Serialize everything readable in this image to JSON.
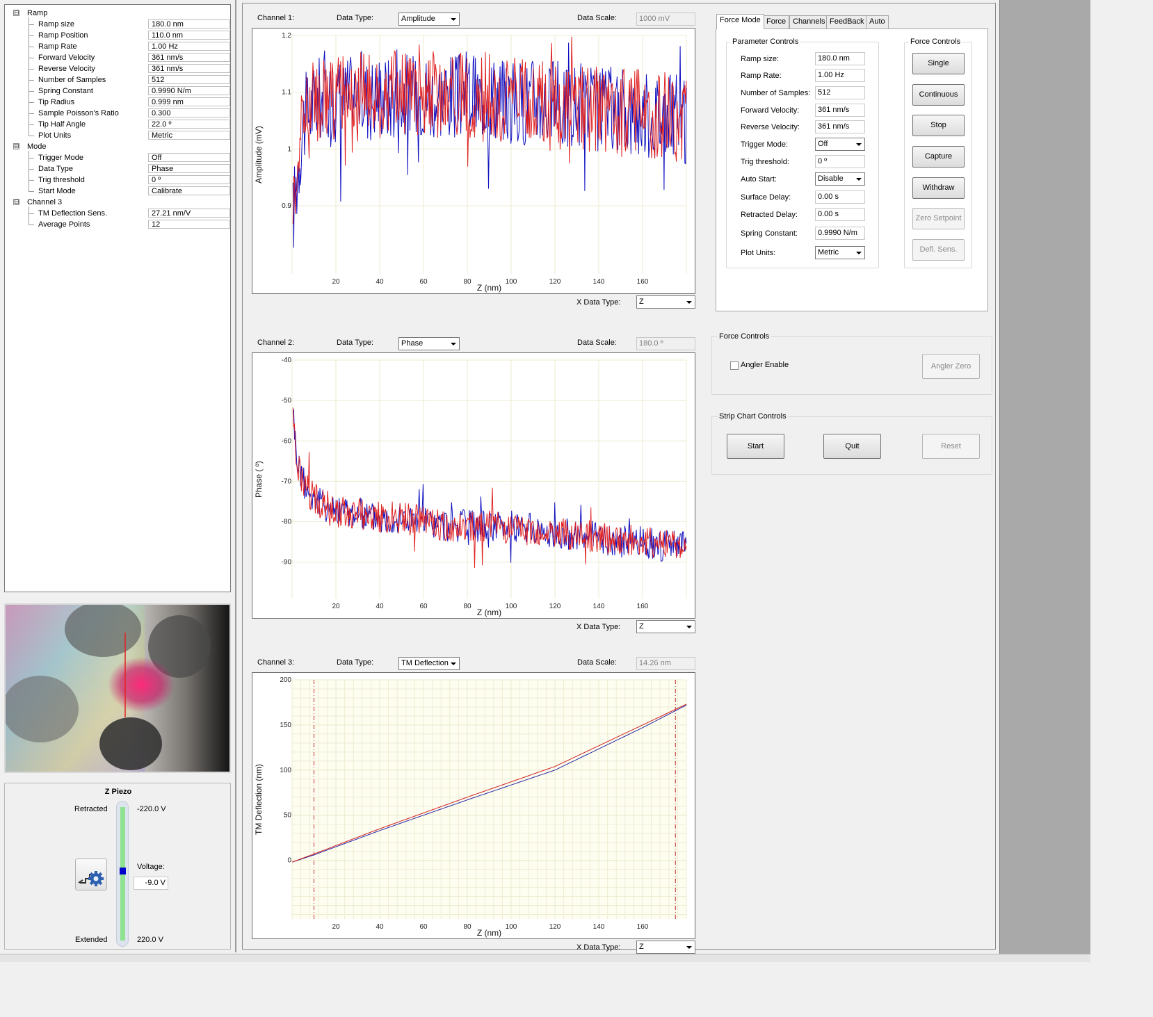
{
  "tree": {
    "sections": [
      {
        "label": "Ramp",
        "toggle": "⊟",
        "rows": [
          {
            "label": "Ramp size",
            "value": "180.0 nm"
          },
          {
            "label": "Ramp Position",
            "value": "110.0 nm"
          },
          {
            "label": "Ramp Rate",
            "value": "1.00 Hz"
          },
          {
            "label": "Forward Velocity",
            "value": "361 nm/s"
          },
          {
            "label": "Reverse Velocity",
            "value": "361 nm/s"
          },
          {
            "label": "Number of Samples",
            "value": "512"
          },
          {
            "label": "Spring Constant",
            "value": "0.9990 N/m"
          },
          {
            "label": "Tip Radius",
            "value": "0.999 nm"
          },
          {
            "label": "Sample Poisson's Ratio",
            "value": "0.300"
          },
          {
            "label": "Tip Half Angle",
            "value": "22.0 º"
          },
          {
            "label": "Plot Units",
            "value": "Metric"
          }
        ]
      },
      {
        "label": "Mode",
        "toggle": "⊟",
        "rows": [
          {
            "label": "Trigger Mode",
            "value": "Off"
          },
          {
            "label": "Data Type",
            "value": "Phase"
          },
          {
            "label": "Trig threshold",
            "value": "0 º"
          },
          {
            "label": "Start Mode",
            "value": "Calibrate"
          }
        ]
      },
      {
        "label": "Channel 3",
        "toggle": "⊟",
        "rows": [
          {
            "label": "TM Deflection Sens.",
            "value": "27.21 nm/V"
          },
          {
            "label": "Average Points",
            "value": "12"
          }
        ]
      }
    ]
  },
  "zpiezo": {
    "title": "Z Piezo",
    "retracted_label": "Retracted",
    "retracted_value": "-220.0 V",
    "extended_label": "Extended",
    "extended_value": "220.0 V",
    "voltage_label": "Voltage:",
    "voltage_value": "-9.0 V",
    "voltage_min": -220,
    "voltage_max": 220,
    "voltage": -9.0,
    "icon": "stepper-gear-icon"
  },
  "channels": [
    {
      "label": "Channel 1:",
      "data_type_label": "Data Type:",
      "data_type": "Amplitude",
      "scale_label": "Data Scale:",
      "scale": "1000 mV",
      "x_type_label": "X Data Type:",
      "x_type": "Z"
    },
    {
      "label": "Channel 2:",
      "data_type_label": "Data Type:",
      "data_type": "Phase",
      "scale_label": "Data Scale:",
      "scale": "180.0 º",
      "x_type_label": "X Data Type:",
      "x_type": "Z"
    },
    {
      "label": "Channel 3:",
      "data_type_label": "Data Type:",
      "data_type": "TM Deflection",
      "scale_label": "Data Scale:",
      "scale": "14.26 nm",
      "x_type_label": "X Data Type:",
      "x_type": "Z"
    }
  ],
  "chart_data": [
    {
      "type": "line",
      "title": "",
      "xlabel": "Z (nm)",
      "ylabel": "Amplitude (mV)",
      "xlim": [
        0,
        180
      ],
      "ylim": [
        0.78,
        1.2
      ],
      "xticks": [
        20,
        40,
        60,
        80,
        100,
        120,
        140,
        160
      ],
      "yticks": [
        0.9,
        1,
        1.1,
        1.2
      ],
      "ytick_labels": [
        "0.9",
        "1",
        "1.1",
        "1.2"
      ],
      "grid": true,
      "series": [
        {
          "color": "#1010c0",
          "x": [
            0.4,
            5,
            10,
            15,
            20,
            25,
            30,
            35,
            40,
            45,
            50,
            55,
            60,
            65,
            70,
            75,
            80,
            85,
            90,
            95,
            100,
            105,
            110,
            115,
            120,
            125,
            130,
            135,
            140,
            145,
            150,
            155,
            160,
            165,
            170,
            175,
            180
          ],
          "y": [
            0.88,
            1.05,
            1.08,
            1.1,
            1.08,
            1.09,
            1.1,
            1.09,
            1.1,
            1.09,
            1.1,
            1.09,
            1.1,
            1.09,
            1.1,
            1.09,
            1.1,
            1.09,
            1.1,
            1.09,
            1.08,
            1.08,
            1.09,
            1.08,
            1.08,
            1.07,
            1.08,
            1.07,
            1.07,
            1.07,
            1.07,
            1.06,
            1.06,
            1.06,
            1.06,
            1.06,
            1.04
          ]
        },
        {
          "color": "#e02020",
          "x": [
            0.4,
            5,
            10,
            15,
            20,
            25,
            30,
            35,
            40,
            45,
            50,
            55,
            60,
            65,
            70,
            75,
            80,
            85,
            90,
            95,
            100,
            105,
            110,
            115,
            120,
            125,
            130,
            135,
            140,
            145,
            150,
            155,
            160,
            165,
            170,
            175,
            180
          ],
          "y": [
            0.92,
            1.06,
            1.08,
            1.09,
            1.09,
            1.1,
            1.09,
            1.1,
            1.09,
            1.1,
            1.09,
            1.1,
            1.09,
            1.1,
            1.09,
            1.1,
            1.09,
            1.1,
            1.09,
            1.08,
            1.09,
            1.08,
            1.08,
            1.08,
            1.07,
            1.08,
            1.07,
            1.07,
            1.07,
            1.07,
            1.06,
            1.07,
            1.06,
            1.06,
            1.06,
            1.05,
            1.05
          ]
        }
      ]
    },
    {
      "type": "line",
      "title": "",
      "xlabel": "Z (nm)",
      "ylabel": "Phase ( º)",
      "xlim": [
        0,
        180
      ],
      "ylim": [
        -99,
        -40
      ],
      "xticks": [
        20,
        40,
        60,
        80,
        100,
        120,
        140,
        160
      ],
      "yticks": [
        -40,
        -50,
        -60,
        -70,
        -80,
        -90
      ],
      "ytick_labels": [
        "-40",
        "-50",
        "-60",
        "-70",
        "-80",
        "-90"
      ],
      "grid": true,
      "series": [
        {
          "color": "#1010c0",
          "x": [
            0.4,
            1,
            2,
            3,
            5,
            8,
            10,
            15,
            20,
            30,
            40,
            50,
            60,
            70,
            80,
            90,
            100,
            110,
            120,
            130,
            140,
            150,
            160,
            170,
            180
          ],
          "y": [
            -50,
            -57,
            -63,
            -66,
            -70,
            -73,
            -74,
            -76,
            -77,
            -78,
            -79,
            -79,
            -80,
            -81,
            -81,
            -81,
            -81,
            -82,
            -83,
            -83,
            -84,
            -85,
            -85,
            -86,
            -86
          ]
        },
        {
          "color": "#e02020",
          "x": [
            0.4,
            1,
            2,
            3,
            5,
            8,
            10,
            15,
            20,
            30,
            40,
            50,
            60,
            70,
            80,
            90,
            100,
            110,
            120,
            130,
            140,
            150,
            160,
            170,
            180
          ],
          "y": [
            -51,
            -58,
            -64,
            -67,
            -71,
            -73,
            -74,
            -76,
            -77,
            -78,
            -79,
            -79,
            -80,
            -81,
            -81,
            -81,
            -82,
            -82,
            -83,
            -83,
            -84,
            -84,
            -85,
            -85,
            -86
          ]
        }
      ]
    },
    {
      "type": "line",
      "title": "",
      "xlabel": "Z (nm)",
      "ylabel": "TM Deflection (nm)",
      "xlim": [
        0,
        180
      ],
      "ylim": [
        -65,
        200
      ],
      "xticks": [
        20,
        40,
        60,
        80,
        100,
        120,
        140,
        160
      ],
      "yticks": [
        0,
        50,
        100,
        150,
        200
      ],
      "ytick_labels": [
        "0",
        "50",
        "100",
        "150",
        "200"
      ],
      "grid": true,
      "minor_grid": true,
      "markers": [
        10,
        175
      ],
      "series": [
        {
          "color": "#2a2aa8",
          "x": [
            0,
            10,
            40,
            80,
            120,
            160,
            180
          ],
          "y": [
            -2,
            6,
            33,
            67,
            100,
            147,
            172
          ]
        },
        {
          "color": "#d02020",
          "x": [
            0,
            10,
            40,
            80,
            120,
            160,
            180
          ],
          "y": [
            -2,
            7,
            35,
            70,
            104,
            150,
            173
          ]
        }
      ]
    }
  ],
  "tabs": [
    "Force Mode",
    "Force",
    "Channels",
    "FeedBack",
    "Auto"
  ],
  "param_controls": {
    "title": "Parameter Controls",
    "rows": [
      {
        "label": "Ramp size:",
        "value": "180.0 nm",
        "kind": "field"
      },
      {
        "label": "Ramp Rate:",
        "value": "1.00 Hz",
        "kind": "field"
      },
      {
        "label": "Number of Samples:",
        "value": "512",
        "kind": "field"
      },
      {
        "label": "Forward Velocity:",
        "value": "361 nm/s",
        "kind": "field"
      },
      {
        "label": "Reverse Velocity:",
        "value": "361 nm/s",
        "kind": "field"
      },
      {
        "label": "Trigger Mode:",
        "value": "Off",
        "kind": "combo"
      },
      {
        "label": "Trig threshold:",
        "value": "0 º",
        "kind": "field"
      },
      {
        "label": "Auto Start:",
        "value": "Disable",
        "kind": "combo"
      },
      {
        "label": "Surface Delay:",
        "value": "0.00 s",
        "kind": "field"
      },
      {
        "label": "Retracted Delay:",
        "value": "0.00 s",
        "kind": "field"
      },
      {
        "label": "Spring Constant:",
        "value": "0.9990 N/m",
        "kind": "field"
      },
      {
        "label": "Plot Units:",
        "value": "Metric",
        "kind": "combo"
      }
    ]
  },
  "force_controls": {
    "title": "Force Controls",
    "buttons": [
      {
        "label": "Single",
        "enabled": true
      },
      {
        "label": "Continuous",
        "enabled": true
      },
      {
        "label": "Stop",
        "enabled": true
      },
      {
        "label": "Capture",
        "enabled": true
      },
      {
        "label": "Withdraw",
        "enabled": true
      },
      {
        "label": "Zero Setpoint",
        "enabled": false
      },
      {
        "label": "Defl. Sens.",
        "enabled": false
      }
    ]
  },
  "angler": {
    "title": "Force Controls",
    "checkbox_label": "Angler Enable",
    "checked": false,
    "button": "Angler Zero"
  },
  "strip_chart": {
    "title": "Strip Chart Controls",
    "start": "Start",
    "quit": "Quit",
    "reset": "Reset"
  },
  "colors": {
    "forward": "#1010c0",
    "reverse": "#e02020",
    "slider_fill": "#90e090",
    "slider_thumb": "#0000cc"
  }
}
